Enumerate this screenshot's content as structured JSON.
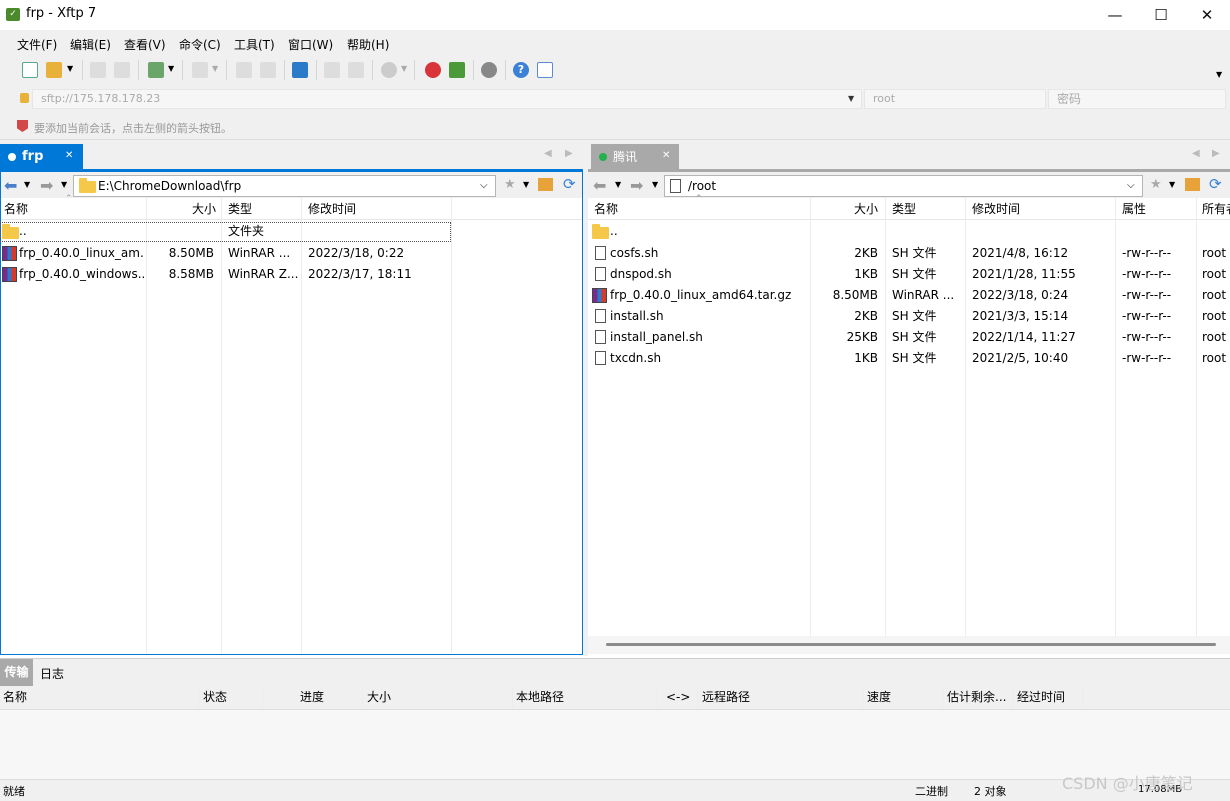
{
  "window": {
    "title": "frp - Xftp 7",
    "icon": "xftp-app-icon",
    "controls": {
      "minimize": "—",
      "maximize": "☐",
      "close": "✕"
    }
  },
  "menu": [
    "文件(F)",
    "编辑(E)",
    "查看(V)",
    "命令(C)",
    "工具(T)",
    "窗口(W)",
    "帮助(H)"
  ],
  "address": {
    "host": "sftp://175.178.178.23",
    "user_placeholder": "root",
    "password_placeholder": "密码"
  },
  "hint": "要添加当前会话，点击左侧的箭头按钮。",
  "local": {
    "tab_label": "frp",
    "path": "E:\\ChromeDownload\\frp",
    "columns": [
      "名称",
      "大小",
      "类型",
      "修改时间"
    ],
    "rows": [
      {
        "name": "..",
        "size": "",
        "type": "文件夹",
        "modified": "",
        "icon": "folder-icon"
      },
      {
        "name": "frp_0.40.0_linux_am...",
        "size": "8.50MB",
        "type": "WinRAR ...",
        "modified": "2022/3/18, 0:22",
        "icon": "rar-icon"
      },
      {
        "name": "frp_0.40.0_windows...",
        "size": "8.58MB",
        "type": "WinRAR Z...",
        "modified": "2022/3/17, 18:11",
        "icon": "rar-icon"
      }
    ]
  },
  "remote": {
    "tab_label": "腾讯",
    "path": "/root",
    "columns": [
      "名称",
      "大小",
      "类型",
      "修改时间",
      "属性",
      "所有者"
    ],
    "rows": [
      {
        "name": "..",
        "size": "",
        "type": "",
        "modified": "",
        "attr": "",
        "owner": "",
        "icon": "folder-icon"
      },
      {
        "name": "cosfs.sh",
        "size": "2KB",
        "type": "SH 文件",
        "modified": "2021/4/8, 16:12",
        "attr": "-rw-r--r--",
        "owner": "root",
        "icon": "file-icon"
      },
      {
        "name": "dnspod.sh",
        "size": "1KB",
        "type": "SH 文件",
        "modified": "2021/1/28, 11:55",
        "attr": "-rw-r--r--",
        "owner": "root",
        "icon": "file-icon"
      },
      {
        "name": "frp_0.40.0_linux_amd64.tar.gz",
        "size": "8.50MB",
        "type": "WinRAR ...",
        "modified": "2022/3/18, 0:24",
        "attr": "-rw-r--r--",
        "owner": "root",
        "icon": "rar-icon"
      },
      {
        "name": "install.sh",
        "size": "2KB",
        "type": "SH 文件",
        "modified": "2021/3/3, 15:14",
        "attr": "-rw-r--r--",
        "owner": "root",
        "icon": "file-icon"
      },
      {
        "name": "install_panel.sh",
        "size": "25KB",
        "type": "SH 文件",
        "modified": "2022/1/14, 11:27",
        "attr": "-rw-r--r--",
        "owner": "root",
        "icon": "file-icon"
      },
      {
        "name": "txcdn.sh",
        "size": "1KB",
        "type": "SH 文件",
        "modified": "2021/2/5, 10:40",
        "attr": "-rw-r--r--",
        "owner": "root",
        "icon": "file-icon"
      }
    ]
  },
  "bottom": {
    "tabs": [
      "传输",
      "日志"
    ],
    "columns": [
      "名称",
      "状态",
      "进度",
      "大小",
      "本地路径",
      "<->",
      "远程路径",
      "速度",
      "估计剩余...",
      "经过时间"
    ]
  },
  "status": {
    "left": "就绪",
    "mode": "二进制",
    "count": "2 对象",
    "size": "17.08MB"
  },
  "watermark": "CSDN @小唐笔记",
  "colors": {
    "accent": "#0078d7",
    "connected": "#22b14c",
    "inactive_tab": "#a9a9a9"
  }
}
